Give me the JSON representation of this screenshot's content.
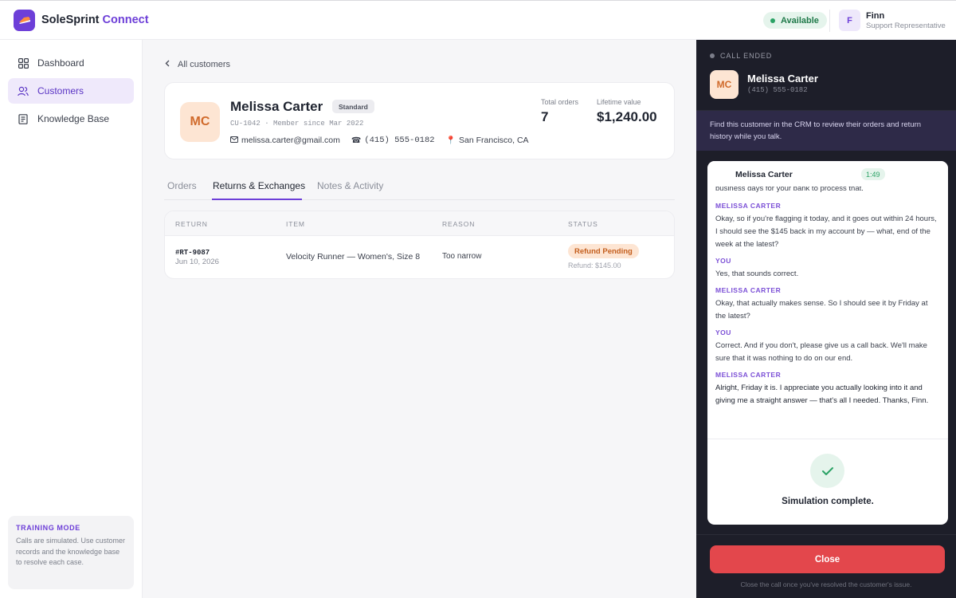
{
  "app": {
    "name_part1": "SoleSprint",
    "name_part2": "Connect"
  },
  "topbar": {
    "status": "Available",
    "user_initial": "F",
    "user_name": "Finn",
    "user_role": "Support Representative"
  },
  "sidebar": {
    "items": [
      {
        "label": "Dashboard",
        "icon": "grid-icon"
      },
      {
        "label": "Customers",
        "icon": "users-icon",
        "active": true
      },
      {
        "label": "Knowledge Base",
        "icon": "book-icon"
      }
    ],
    "training": {
      "title": "TRAINING MODE",
      "text": "Calls are simulated. Use customer records and the knowledge base to resolve each case."
    }
  },
  "main": {
    "back_label": "All customers",
    "customer": {
      "initials": "MC",
      "name": "Melissa Carter",
      "tier": "Standard",
      "meta": "CU-1042 · Member since Mar 2022",
      "email": "melissa.carter@gmail.com",
      "phone": "(415) 555-0182",
      "location": "San Francisco, CA",
      "total_orders_label": "Total orders",
      "total_orders": "7",
      "lifetime_label": "Lifetime value",
      "lifetime_value": "$1,240.00"
    },
    "tabs": [
      {
        "label": "Orders"
      },
      {
        "label": "Returns & Exchanges",
        "active": true
      },
      {
        "label": "Notes & Activity"
      }
    ],
    "table": {
      "headers": [
        "RETURN",
        "ITEM",
        "REASON",
        "STATUS"
      ],
      "rows": [
        {
          "id": "#RT-9087",
          "date": "Jun 10, 2026",
          "item": "Velocity Runner — Women's, Size 8",
          "reason": "Too narrow",
          "status": "Refund Pending",
          "refund": "Refund: $145.00"
        }
      ]
    }
  },
  "call": {
    "state": "CALL ENDED",
    "initials": "MC",
    "name": "Melissa Carter",
    "phone": "(415) 555-0182",
    "hint": "Find this customer in the CRM to review their orders and return history while you talk.",
    "transcript": {
      "name": "Melissa Carter",
      "timer": "1:49",
      "cut_text": "business days for your bank to process that.",
      "messages": [
        {
          "speaker": "MELISSA CARTER",
          "text": "Okay, so if you're flagging it today, and it goes out within 24 hours, I should see the $145 back in my account by — what, end of the week at the latest?"
        },
        {
          "speaker": "YOU",
          "text": "Yes, that sounds correct."
        },
        {
          "speaker": "MELISSA CARTER",
          "text": "Okay, that actually makes sense. So I should see it by Friday at the latest?"
        },
        {
          "speaker": "YOU",
          "text": "Correct. And if you don't, please give us a call back. We'll make sure that it was nothing to do on our end."
        },
        {
          "speaker": "MELISSA CARTER",
          "text": "Alright, Friday it is. I appreciate you actually looking into it and giving me a straight answer — that's all I needed. Thanks, Finn."
        }
      ],
      "complete": "Simulation complete."
    },
    "close_label": "Close",
    "close_hint": "Close the call once you've resolved the customer's issue."
  },
  "colors": {
    "accent": "#6d3fd8",
    "available": "#2aa265",
    "danger": "#e3474c",
    "panel_bg": "#1d1e29"
  }
}
